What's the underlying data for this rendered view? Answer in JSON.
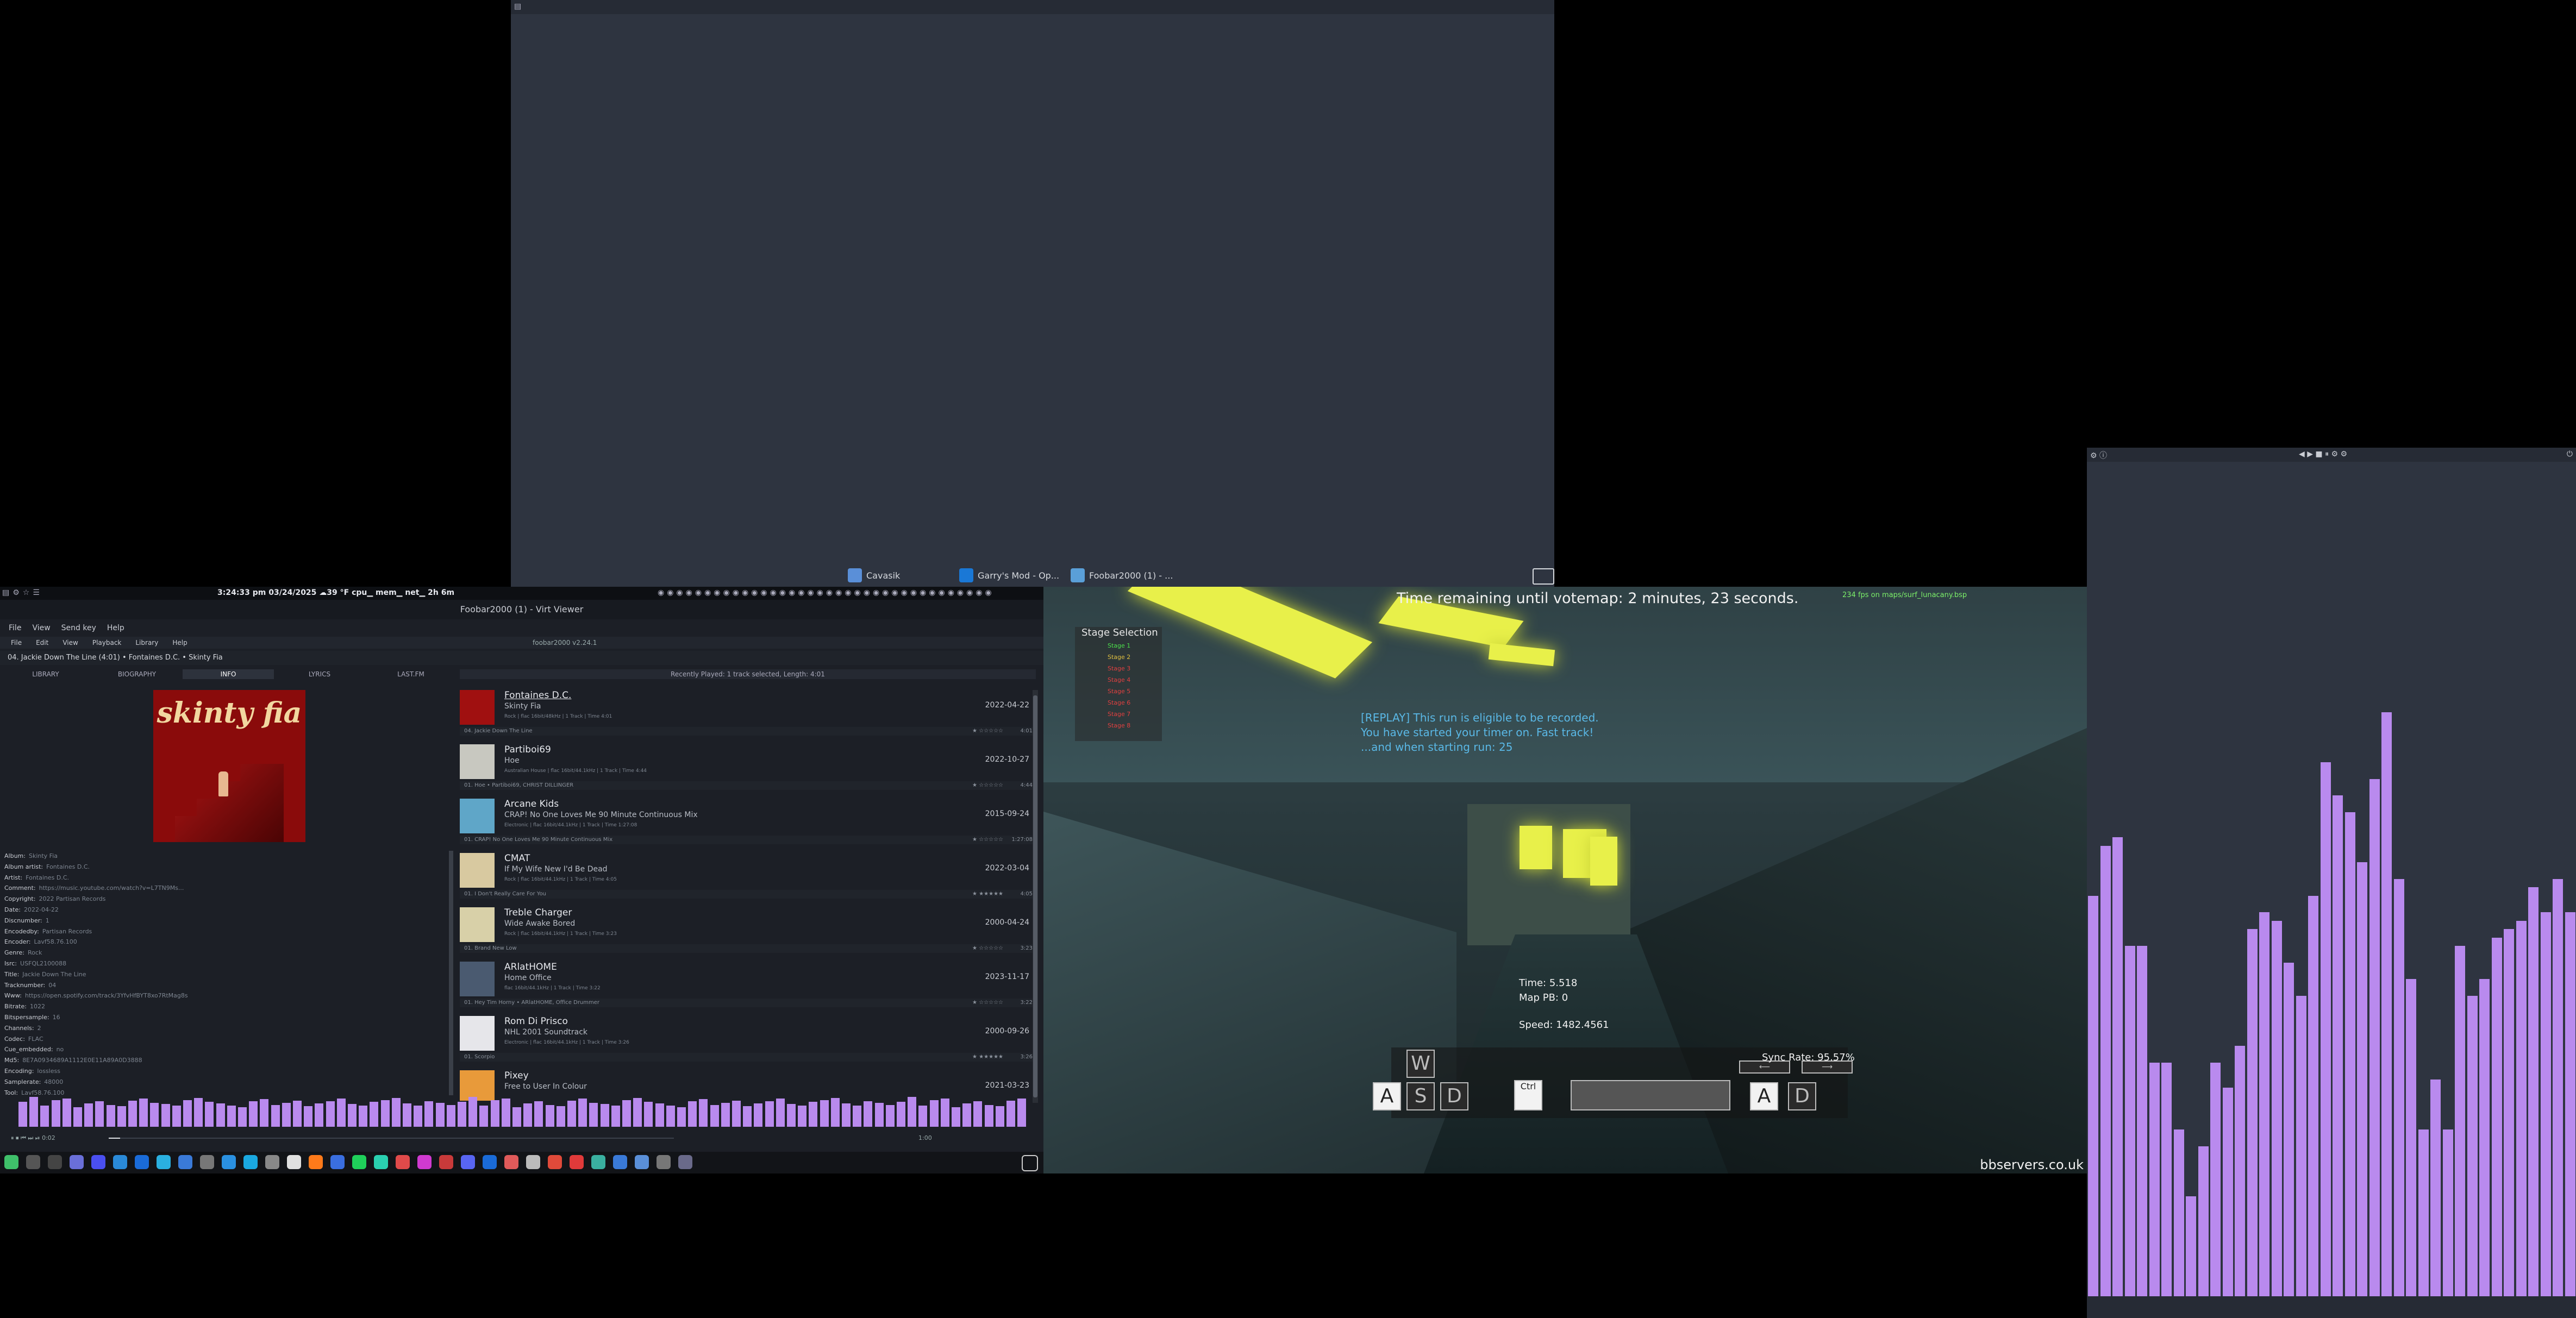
{
  "taskbar_top": {
    "items": [
      {
        "label": "Cavasik",
        "icon": "cavasik-icon"
      },
      {
        "label": "Garry's Mod - Op...",
        "icon": "gmod-icon"
      },
      {
        "label": "Foobar2000 (1) - ...",
        "icon": "foobar-icon"
      }
    ]
  },
  "statusbar": {
    "clock": "3:24:33 pm  03/24/2025  ☁39 °F  cpu▁ mem▁ net▁  2h 6m"
  },
  "foobar": {
    "window_title": "Foobar2000 (1) - Virt Viewer",
    "menu": [
      "File",
      "View",
      "Send key",
      "Help"
    ],
    "inner_title": "foobar2000 v2.24.1",
    "inner_menu": [
      "File",
      "Edit",
      "View",
      "Playback",
      "Library",
      "Help"
    ],
    "now_playing": "04. Jackie Down The Line (4:01)  •  Fontaines D.C.  •  Skinty Fia",
    "tabs": [
      "LIBRARY",
      "BIOGRAPHY",
      "INFO",
      "LYRICS",
      "LAST.FM"
    ],
    "active_tab": 2,
    "recent_bar": "Recently Played: 1 track selected, Length: 4:01",
    "album_art_text": "skinty fia",
    "metadata": [
      {
        "k": "Album:",
        "v": "Skinty Fia"
      },
      {
        "k": "Album artist:",
        "v": "Fontaines D.C."
      },
      {
        "k": "Artist:",
        "v": "Fontaines D.C."
      },
      {
        "k": "Comment:",
        "v": "https://music.youtube.com/watch?v=L7TN9Ms..."
      },
      {
        "k": "Copyright:",
        "v": "2022 Partisan Records"
      },
      {
        "k": "Date:",
        "v": "2022-04-22"
      },
      {
        "k": "Discnumber:",
        "v": "1"
      },
      {
        "k": "Encodedby:",
        "v": "Partisan Records"
      },
      {
        "k": "Encoder:",
        "v": "Lavf58.76.100"
      },
      {
        "k": "Genre:",
        "v": "Rock"
      },
      {
        "k": "Isrc:",
        "v": "USFQL2100088"
      },
      {
        "k": "Title:",
        "v": "Jackie Down The Line"
      },
      {
        "k": "Tracknumber:",
        "v": "04"
      },
      {
        "k": "Www:",
        "v": "https://open.spotify.com/track/3YfvHfBYT8xo7RtMag8s"
      },
      {
        "k": "Bitrate:",
        "v": "1022"
      },
      {
        "k": "Bitspersample:",
        "v": "16"
      },
      {
        "k": "Channels:",
        "v": "2"
      },
      {
        "k": "Codec:",
        "v": "FLAC"
      },
      {
        "k": "Cue_embedded:",
        "v": "no"
      },
      {
        "k": "Md5:",
        "v": "8E7A0934689A1112E0E11A89A0D3888"
      },
      {
        "k": "Encoding:",
        "v": "lossless"
      },
      {
        "k": "Samplerate:",
        "v": "48000"
      },
      {
        "k": "Tool:",
        "v": "Lavf58.76.100"
      }
    ],
    "playlist": [
      {
        "artist": "Fontaines D.C.",
        "album": "Skinty Fia",
        "info": "Rock | flac 16bit/48kHz | 1 Track | Time 4:01",
        "date": "2022-04-22",
        "track": "04. Jackie Down The Line",
        "rating": "★ ☆☆☆☆☆",
        "length": "4:01",
        "color": "#a01010"
      },
      {
        "artist": "Partiboi69",
        "album": "Hoe",
        "info": "Australian House | flac 16bit/44.1kHz | 1 Track | Time 4:44",
        "date": "2022-10-27",
        "track": "01. Hoe • Partiboi69, CHRIST DILLINGER",
        "rating": "★ ☆☆☆☆☆",
        "length": "4:44",
        "color": "#c8c8c0"
      },
      {
        "artist": "Arcane Kids",
        "album": "CRAP! No One Loves Me 90 Minute Continuous Mix",
        "info": "Electronic | flac 16bit/44.1kHz | 1 Track | Time 1:27:08",
        "date": "2015-09-24",
        "track": "01. CRAP! No One Loves Me 90 Minute Continuous Mix",
        "rating": "★ ☆☆☆☆☆",
        "length": "1:27:08",
        "color": "#5fa6c8"
      },
      {
        "artist": "CMAT",
        "album": "If My Wife New I'd Be Dead",
        "info": "Rock | flac 16bit/44.1kHz | 1 Track | Time 4:05",
        "date": "2022-03-04",
        "track": "01. I Don't Really Care For You",
        "rating": "★ ★★★★★",
        "length": "4:05",
        "color": "#d8c9a0"
      },
      {
        "artist": "Treble Charger",
        "album": "Wide Awake Bored",
        "info": "Rock | flac 16bit/44.1kHz | 1 Track | Time 3:23",
        "date": "2000-04-24",
        "track": "01. Brand New Low",
        "rating": "★ ☆☆☆☆☆",
        "length": "3:23",
        "color": "#d8d0a8"
      },
      {
        "artist": "ARlatHOME",
        "album": "Home Office",
        "info": "flac 16bit/44.1kHz | 1 Track | Time 3:22",
        "date": "2023-11-17",
        "track": "01. Hey Tim Horny • ARlatHOME, Office Drummer",
        "rating": "★ ☆☆☆☆☆",
        "length": "3:22",
        "color": "#4a5a70"
      },
      {
        "artist": "Rom Di Prisco",
        "album": "NHL 2001 Soundtrack",
        "info": "Electronic | flac 16bit/44.1kHz | 1 Track | Time 3:26",
        "date": "2000-09-26",
        "track": "01. Scorpio",
        "rating": "★ ★★★★★",
        "length": "3:26",
        "color": "#e6e6ea"
      },
      {
        "artist": "Pixey",
        "album": "Free to User In Colour",
        "info": "",
        "date": "2021-03-23",
        "track": "",
        "rating": "",
        "length": "",
        "color": "#e89a3a"
      }
    ],
    "seek": {
      "elapsed": "0:02",
      "total": "1:00",
      "label_left": "⏸  ⏹  ⏮  ⏭  ⏯  0:02",
      "progress": 0.02
    }
  },
  "game": {
    "vote_msg": "Time remaining until votemap: 2 minutes, 23 seconds.",
    "fps": "234 fps on maps/surf_lunacany.bsp",
    "stage_title": "Stage Selection",
    "stages": [
      {
        "label": "Stage 1",
        "color": "#4ce04c"
      },
      {
        "label": "Stage 2",
        "color": "#e0c040"
      },
      {
        "label": "Stage 3",
        "color": "#e04040"
      },
      {
        "label": "Stage 4",
        "color": "#e04040"
      },
      {
        "label": "Stage 5",
        "color": "#e04040"
      },
      {
        "label": "Stage 6",
        "color": "#e04040"
      },
      {
        "label": "Stage 7",
        "color": "#e04040"
      },
      {
        "label": "Stage 8",
        "color": "#e04040"
      }
    ],
    "replay_lines": [
      "[REPLAY] This run is eligible to be recorded.",
      "You have started your timer on. Fast track!",
      "...and when starting run: 25"
    ],
    "time_label": "Time:  5.518",
    "mappb_label": "Map PB:  0",
    "speed_label": "Speed: 1482.4561",
    "sync_label": "Sync Rate: 95.57%",
    "keys": {
      "w": "W",
      "a": "A",
      "s": "S",
      "d": "D",
      "ctrl": "Ctrl",
      "a2": "A",
      "d2": "D"
    },
    "watermark": "bbservers.co.uk"
  },
  "colors": {
    "accent": "#b98aee",
    "bg": "#2e3440"
  },
  "visualizer": {
    "bars": [
      0.48,
      0.54,
      0.55,
      0.42,
      0.42,
      0.28,
      0.28,
      0.2,
      0.12,
      0.18,
      0.28,
      0.25,
      0.3,
      0.44,
      0.46,
      0.45,
      0.4,
      0.36,
      0.48,
      0.64,
      0.6,
      0.58,
      0.52,
      0.62,
      0.7,
      0.5,
      0.38,
      0.2,
      0.26,
      0.2,
      0.42,
      0.36,
      0.38,
      0.43,
      0.44,
      0.45,
      0.49,
      0.46,
      0.5,
      0.46
    ],
    "small": [
      0.35,
      0.42,
      0.3,
      0.38,
      0.4,
      0.28,
      0.33,
      0.36,
      0.31,
      0.29,
      0.37,
      0.4,
      0.34,
      0.32,
      0.3,
      0.38,
      0.41,
      0.35,
      0.33,
      0.3,
      0.28,
      0.36,
      0.39,
      0.31,
      0.34,
      0.37,
      0.29,
      0.33,
      0.36,
      0.4,
      0.32,
      0.3,
      0.35,
      0.38,
      0.41,
      0.33,
      0.3,
      0.36,
      0.34,
      0.31
    ]
  }
}
